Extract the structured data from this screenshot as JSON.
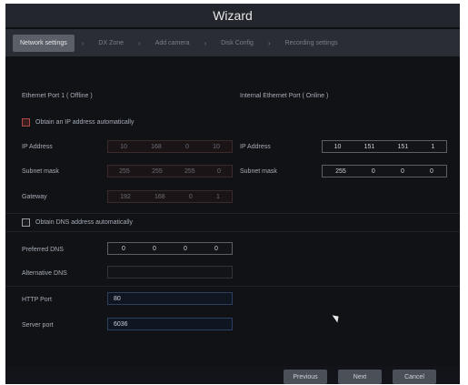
{
  "window": {
    "title": "Wizard"
  },
  "steps": [
    {
      "label": "Network settings",
      "active": true
    },
    {
      "label": "DX Zone"
    },
    {
      "label": "Add camera"
    },
    {
      "label": "Disk Config"
    },
    {
      "label": "Recording settings"
    }
  ],
  "network": {
    "port_left_label": "Ethernet Port 1 ( Offline )",
    "port_right_label": "Internal Ethernet Port ( Online )",
    "obtain_ip_label": "Obtain an IP address automatically",
    "ip_address_label": "IP Address",
    "subnet_mask_label": "Subnet mask",
    "gateway_label": "Gateway",
    "left": {
      "ip": [
        "10",
        "168",
        "0",
        "10"
      ],
      "subnet": [
        "255",
        "255",
        "255",
        "0"
      ],
      "gateway": [
        "192",
        "168",
        "0",
        "1"
      ]
    },
    "right": {
      "ip": [
        "10",
        "151",
        "151",
        "1"
      ],
      "subnet": [
        "255",
        "0",
        "0",
        "0"
      ]
    },
    "obtain_dns_label": "Obtain DNS address automatically",
    "preferred_dns_label": "Preferred DNS",
    "alternative_dns_label": "Alternative DNS",
    "preferred_dns": [
      "0",
      "0",
      "0",
      "0"
    ],
    "alternative_dns_value": "",
    "http_port_label": "HTTP Port",
    "http_port_value": "80",
    "server_port_label": "Server port",
    "server_port_value": "6036"
  },
  "buttons": {
    "previous": "Previous",
    "next": "Next",
    "cancel": "Cancel"
  },
  "colors": {
    "background": "#0d0f12",
    "title_bar": "#23262c",
    "step_active": "#5a5f68",
    "field_border": "#2b3f63",
    "checkbox_border": "#b04a4a"
  }
}
